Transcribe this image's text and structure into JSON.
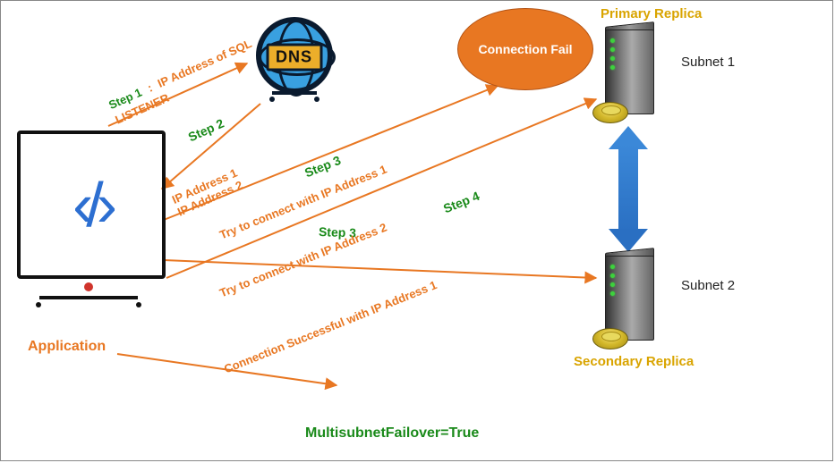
{
  "titles": {
    "primary": "Primary Replica",
    "secondary": "Secondary Replica",
    "application": "Application",
    "footer": "MultisubnetFailover=True"
  },
  "icons": {
    "dns_label": "DNS",
    "code_glyph": "‹/›"
  },
  "fail_bubble": "Connection\nFail",
  "servers": {
    "subnet1": "Subnet 1",
    "subnet2": "Subnet 2"
  },
  "steps": {
    "s1": {
      "name": "Step 1",
      "text": "IP Address of SQL\nLISTENER"
    },
    "s2": {
      "name": "Step 2",
      "text": "IP Address 1\nIP Address 2"
    },
    "s3a": {
      "name": "Step 3",
      "text": "Try to connect with IP Address 1"
    },
    "s3b": {
      "name": "Step 3",
      "text": "Try to connect with IP Address 2"
    },
    "s4": {
      "name": "Step 4",
      "text": "Connection Successful with IP Address 1"
    }
  },
  "colors": {
    "arrow": "#e87722",
    "green": "#1a8a1a",
    "gold": "#d9a400",
    "blue": "#2a6fc2"
  }
}
